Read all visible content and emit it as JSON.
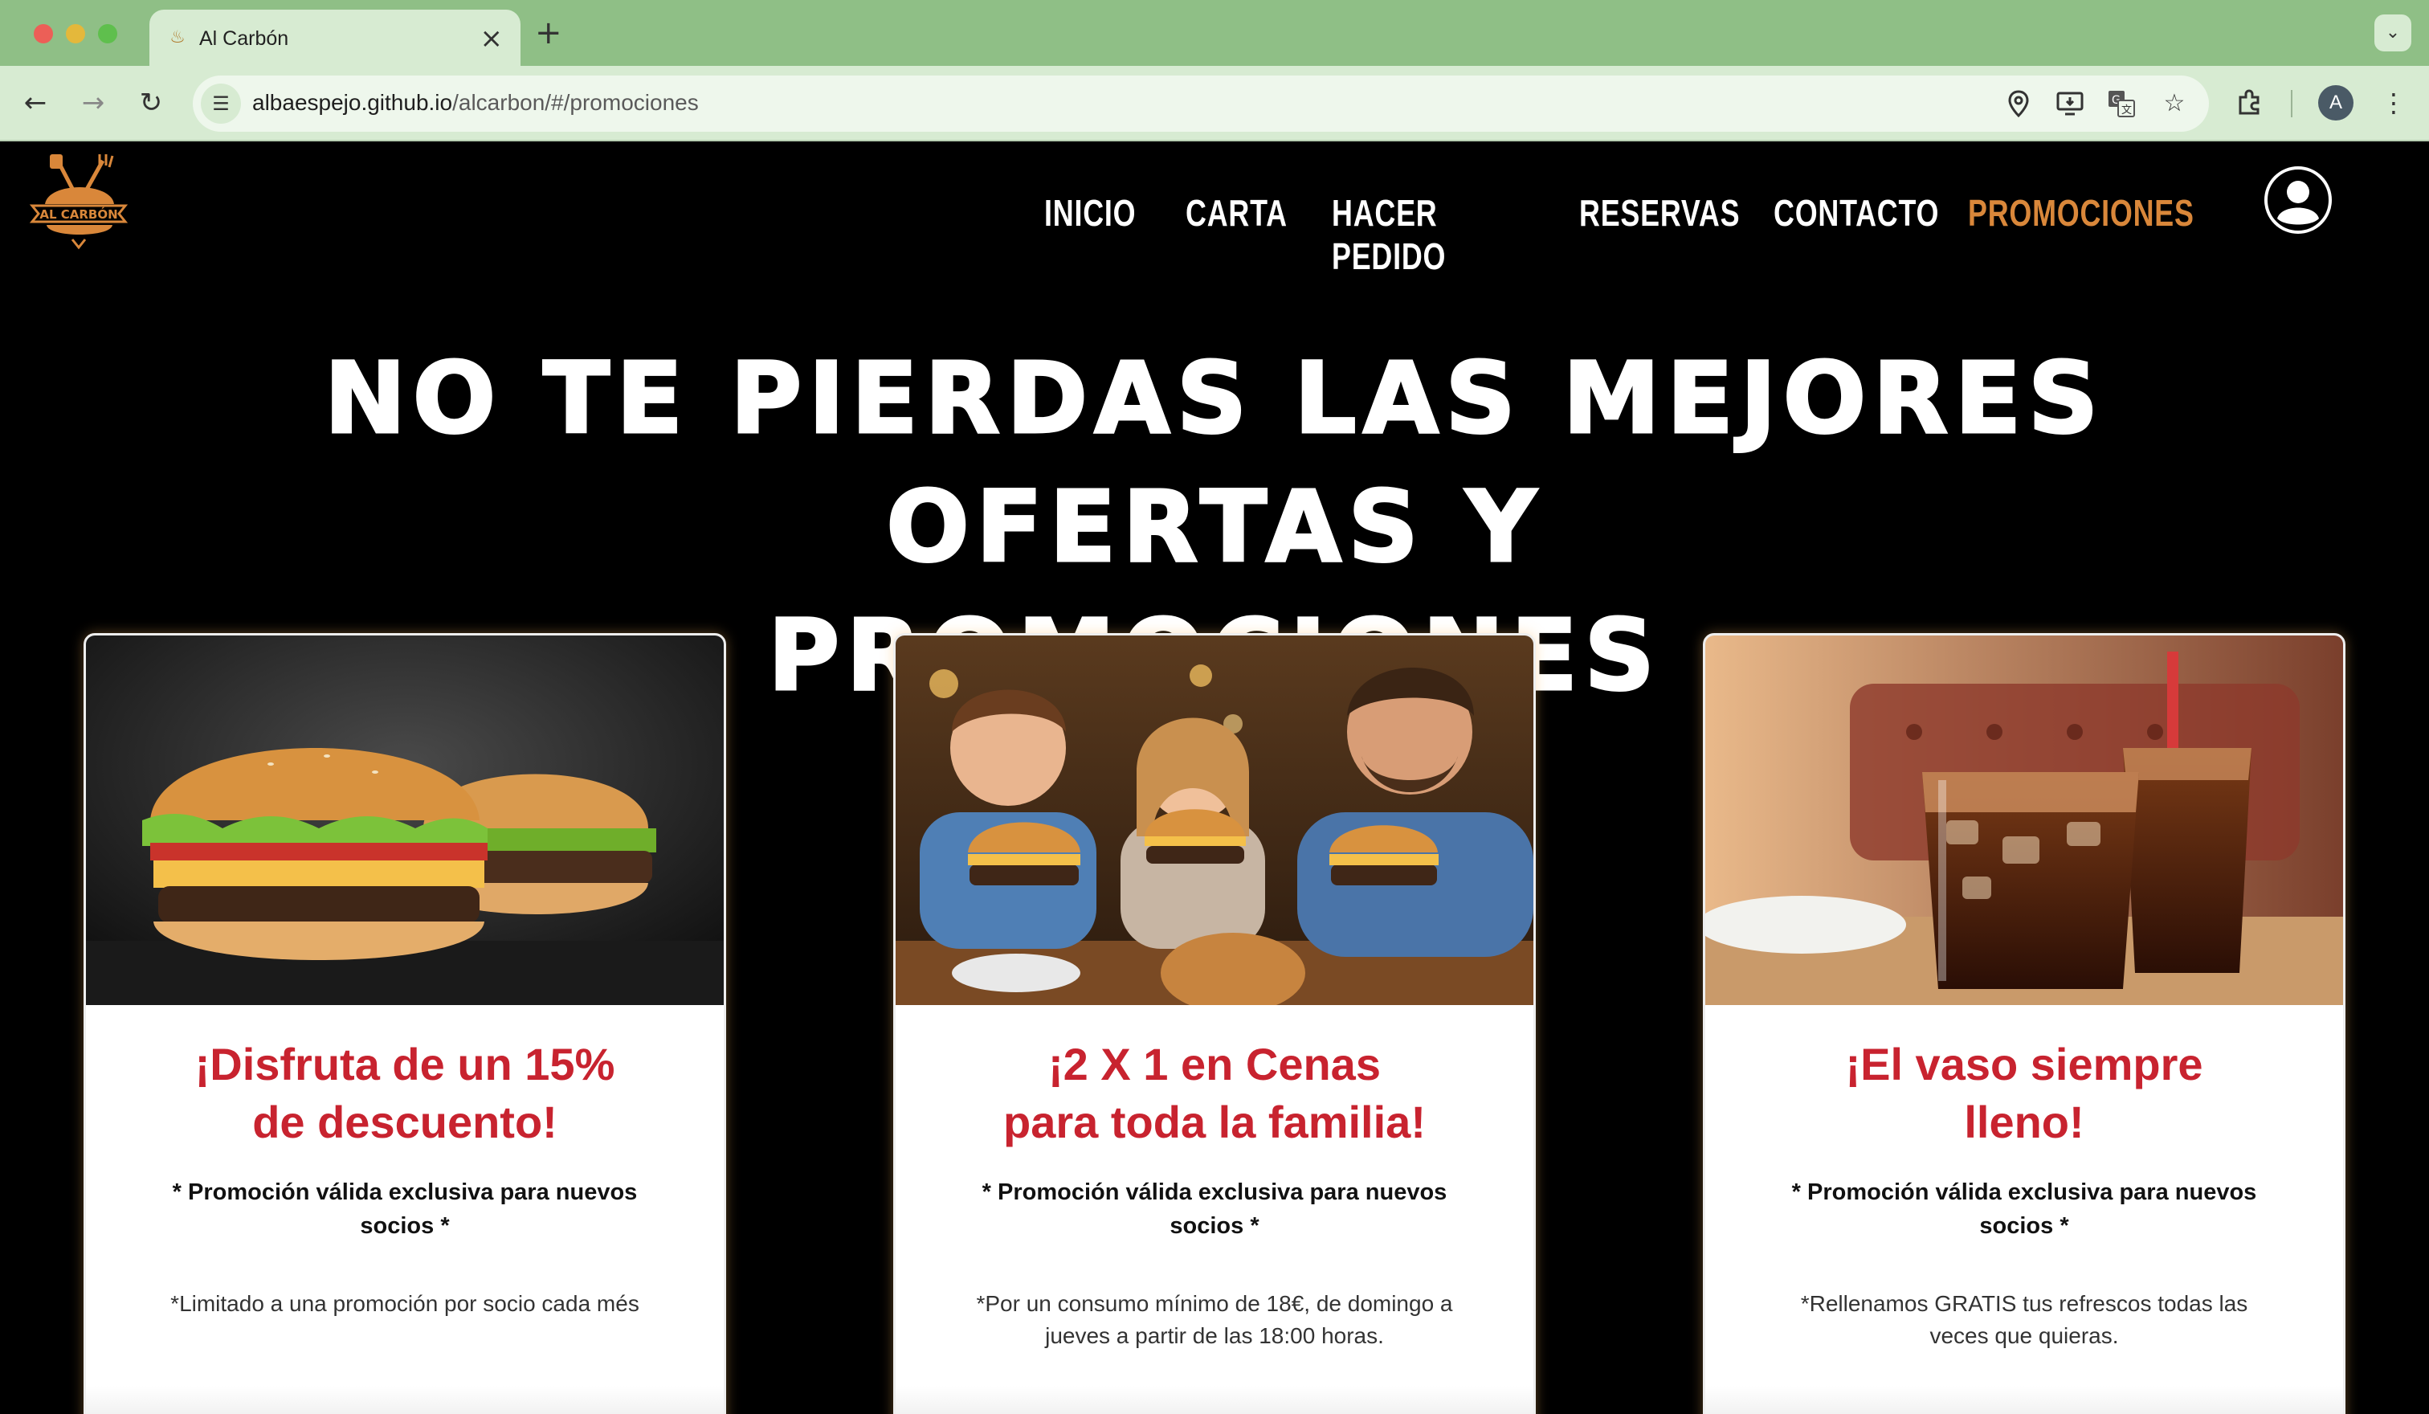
{
  "browser": {
    "tab_title": "Al Carbón",
    "tab_close_icon": "×",
    "new_tab_icon": "+",
    "tab_menu_icon": "⌄",
    "url_host": "albaespejo.github.io",
    "url_path": "/alcarbon/#/promociones",
    "profile_initial": "A",
    "icons": [
      "back-icon",
      "forward-icon",
      "reload-icon",
      "site-info-icon",
      "location-icon",
      "install-app-icon",
      "translate-icon",
      "bookmark-star-icon",
      "extensions-icon",
      "more-menu-icon"
    ]
  },
  "site": {
    "brand": "AL CARBÓN",
    "nav": [
      {
        "label": "INICIO",
        "active": false
      },
      {
        "label": "CARTA",
        "active": false
      },
      {
        "label": "HACER PEDIDO",
        "active": false
      },
      {
        "label": "RESERVAS",
        "active": false
      },
      {
        "label": "CONTACTO",
        "active": false
      },
      {
        "label": "PROMOCIONES",
        "active": true
      }
    ],
    "hero_line1": "NO TE PIERDAS LAS MEJORES OFERTAS Y",
    "hero_line2": "PROMOCIONES",
    "colors": {
      "accent": "#d9873a",
      "title_red": "#c8232f",
      "background": "#000000"
    }
  },
  "promotions": [
    {
      "image": "burgers-photo",
      "title_line1": "¡Disfruta de un 15%",
      "title_line2": "de descuento!",
      "terms": "* Promoción válida exclusiva para nuevos socios *",
      "note": "*Limitado a una promoción por socio cada més"
    },
    {
      "image": "family-eating-burgers-photo",
      "title_line1": "¡2 X 1 en Cenas",
      "title_line2": "para toda la familia!",
      "terms": "* Promoción válida exclusiva para nuevos socios *",
      "note": "*Por un consumo mínimo de 18€, de domingo a jueves a partir de las 18:00 horas."
    },
    {
      "image": "cola-glasses-photo",
      "title_line1": "¡El vaso siempre",
      "title_line2": "lleno!",
      "terms": "* Promoción válida exclusiva para nuevos socios *",
      "note": "*Rellenamos GRATIS tus refrescos todas las veces que quieras."
    }
  ]
}
